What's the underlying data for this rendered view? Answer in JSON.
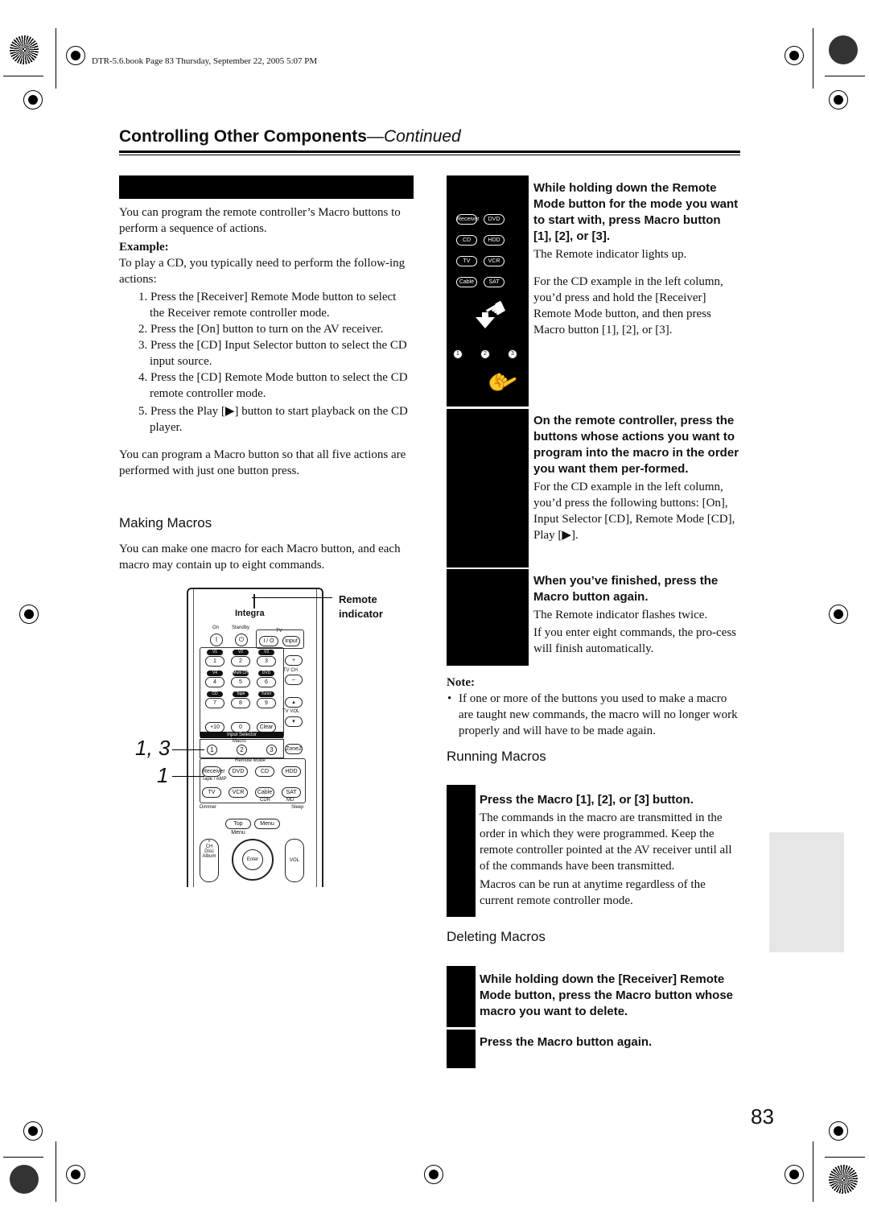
{
  "print_header": "DTR-5.6.book  Page 83  Thursday, September 22, 2005  5:07 PM",
  "title": {
    "main": "Controlling Other Components",
    "suffix": "—Continued"
  },
  "left": {
    "intro": "You can program the remote controller’s Macro buttons to perform a sequence of actions.",
    "example_label": "Example:",
    "example_text": "To play a CD, you typically need to perform the follow-ing actions:",
    "steps": [
      "1. Press the [Receiver] Remote Mode button to select the Receiver remote controller mode.",
      "2. Press the [On] button to turn on the AV receiver.",
      "3. Press the [CD] Input Selector button to select the CD input source.",
      "4. Press the [CD] Remote Mode button to select the CD remote controller mode.",
      "5. Press the Play [▶] button to start playback on the CD player."
    ],
    "summary": "You can program a Macro button so that all five actions are performed with just one button press.",
    "making_heading": "Making Macros",
    "making_text": "You can make one macro for each Macro button, and each macro may contain up to eight commands.",
    "callout_remote_indicator": "Remote indicator",
    "callout_13": "1, 3",
    "callout_1": "1"
  },
  "remote": {
    "brand": "Integra",
    "on": "On",
    "standby": "Standby",
    "tv": "TV",
    "io": "I / O",
    "input": "Input",
    "row_labels": [
      [
        "V1",
        "V2",
        "V3"
      ],
      [
        "V4",
        "Multi CH",
        "DVD"
      ],
      [
        "CD",
        "Tape",
        "Tuner"
      ]
    ],
    "digits": [
      [
        "1",
        "2",
        "3"
      ],
      [
        "4",
        "5",
        "6"
      ],
      [
        "7",
        "8",
        "9"
      ],
      [
        "+10",
        "0",
        "Clear"
      ]
    ],
    "tv_ch": "TV CH",
    "tv_vol": "TV VOL",
    "input_selector": "Input Selector",
    "macro": "Macro",
    "zone2": "Zone2",
    "remote_mode": "Remote Mode",
    "modes": [
      "Receiver",
      "DVD",
      "CD",
      "HDD",
      "TV",
      "VCR",
      "Cable",
      "SAT"
    ],
    "tape_amp": "Tape / AMP",
    "cdr": "CDR",
    "md": "MD",
    "dimmer": "Dimmer",
    "sleep": "Sleep",
    "top_menu": "Top Menu",
    "menu": "Menu",
    "enter": "Enter",
    "ch": "CH",
    "disc_album": "Disc Album",
    "vol": "VOL"
  },
  "right": {
    "step1_head": "While holding down the Remote Mode button for the mode you want to start with, press Macro button [1], [2], or [3].",
    "step1_p1": "The Remote indicator lights up.",
    "step1_p2": "For the CD example in the left column, you’d press and hold the [Receiver] Remote Mode button, and then press Macro button [1], [2], or [3].",
    "step1_img_buttons": [
      "Receiver",
      "DVD",
      "CD",
      "HDD",
      "TV",
      "VCR",
      "Cable",
      "SAT"
    ],
    "step1_img_macros": [
      "1",
      "2",
      "3"
    ],
    "step2_head": "On the remote controller, press the buttons whose actions you want to program into the macro in the order you want them per-formed.",
    "step2_p1": "For the CD example in the left column, you’d press the following buttons: [On], Input Selector [CD], Remote Mode [CD], Play [▶].",
    "step3_head": "When you’ve finished, press the Macro button again.",
    "step3_p1": "The Remote indicator flashes twice.",
    "step3_p2": "If you enter eight commands, the pro-cess will finish automatically.",
    "note_label": "Note:",
    "note_text": "If one or more of the buttons you used to make a macro are taught new commands, the macro will no longer work properly and will have to be made again.",
    "running_heading": "Running Macros",
    "run_head": "Press the Macro [1], [2], or [3] button.",
    "run_p1": "The commands in the macro are transmitted in the order in which they were programmed. Keep the remote controller pointed at the AV receiver until all of the commands have been transmitted.",
    "run_p2": "Macros can be run at anytime regardless of the current remote controller mode.",
    "deleting_heading": "Deleting Macros",
    "del1_head": "While holding down the [Receiver] Remote Mode button, press the Macro button whose macro you want to delete.",
    "del2_head": "Press the Macro button again."
  },
  "page_number": "83",
  "colors": {
    "text": "#111111",
    "step_box": "#000000",
    "side_tab": "#e6e6e6"
  }
}
